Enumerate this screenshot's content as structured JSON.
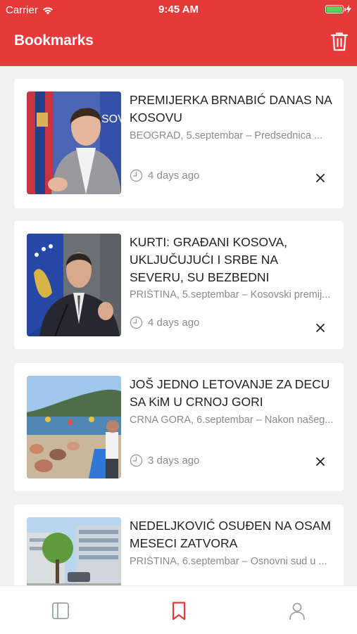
{
  "status_bar": {
    "carrier": "Carrier",
    "time": "9:45 AM",
    "battery_color": "#5fd35f"
  },
  "header": {
    "title": "Bookmarks",
    "background": "#e53a3a",
    "action_icon": "trash-icon"
  },
  "articles": [
    {
      "title": "PREMIJERKA BRNABIĆ DANAS NA KOSOVU",
      "summary": "BEOGRAD, 5.septembar – Predsednica ...",
      "time_ago": "4 days ago"
    },
    {
      "title": "KURTI: GRAĐANI KOSOVA, UKLJUČUJUĆI I SRBE NA SEVERU, SU BEZBEDNI",
      "summary": "PRIŠTINA, 5.septembar – Kosovski premij...",
      "time_ago": "4 days ago"
    },
    {
      "title": "JOŠ JEDNO LETOVANJE ZA DECU SA KiM U CRNOJ GORI",
      "summary": "CRNA GORA, 6.septembar – Nakon našeg...",
      "time_ago": "3 days ago"
    },
    {
      "title": "NEDELJKOVIĆ OSUĐEN NA OSAM MESECI ZATVORA",
      "summary": "PRIŠTINA, 6.septembar – Osnovni sud u ...",
      "time_ago": ""
    }
  ],
  "tab_bar": {
    "tabs": [
      {
        "name": "feed",
        "icon": "sidebar-icon",
        "active": false
      },
      {
        "name": "bookmarks",
        "icon": "bookmark-icon",
        "active": true
      },
      {
        "name": "profile",
        "icon": "user-icon",
        "active": false
      }
    ],
    "active_color": "#e53a3a",
    "inactive_color": "#9aa3a8"
  }
}
